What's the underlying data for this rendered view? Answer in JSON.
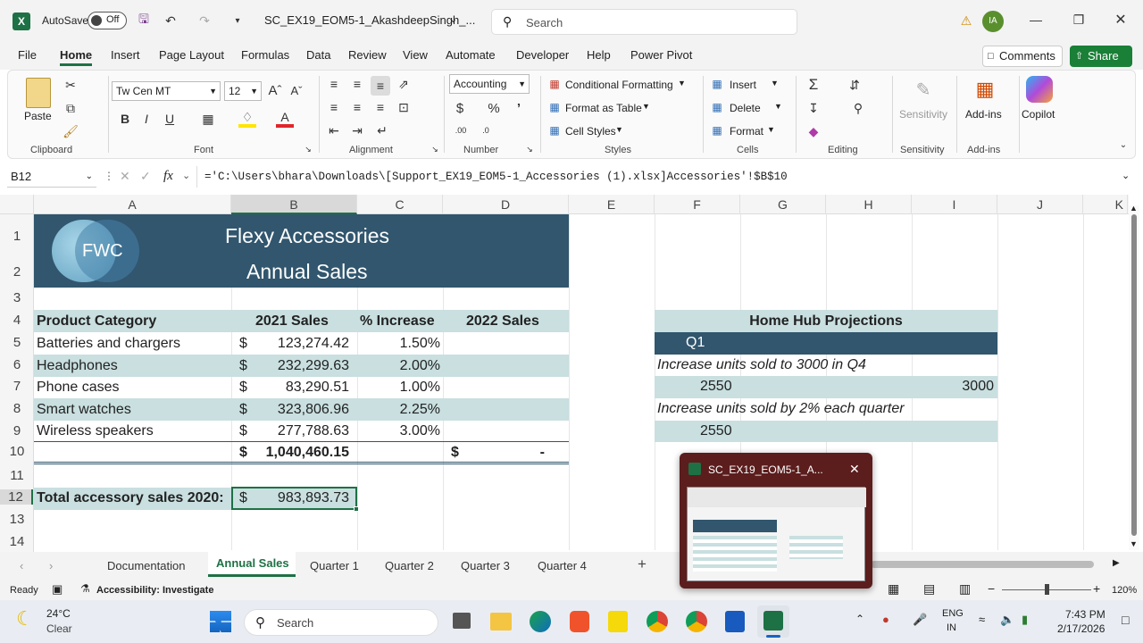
{
  "titlebar": {
    "autosave_label": "AutoSave",
    "autosave_state": "Off",
    "filename": "SC_EX19_EOM5-1_AkashdeepSingh_...",
    "search_placeholder": "Search",
    "avatar_initials": "IA"
  },
  "menu": {
    "items": [
      "File",
      "Home",
      "Insert",
      "Page Layout",
      "Formulas",
      "Data",
      "Review",
      "View",
      "Automate",
      "Developer",
      "Help",
      "Power Pivot"
    ],
    "comments": "Comments",
    "share": "Share"
  },
  "ribbon": {
    "clipboard": {
      "paste": "Paste",
      "label": "Clipboard"
    },
    "font": {
      "name": "Tw Cen MT",
      "size": "12",
      "label": "Font"
    },
    "alignment": {
      "label": "Alignment"
    },
    "number": {
      "format": "Accounting",
      "label": "Number"
    },
    "styles": {
      "conditional": "Conditional Formatting",
      "format_table": "Format as Table",
      "cell_styles": "Cell Styles",
      "label": "Styles"
    },
    "cells": {
      "insert": "Insert",
      "delete": "Delete",
      "format": "Format",
      "label": "Cells"
    },
    "editing": {
      "label": "Editing"
    },
    "sensitivity": {
      "button": "Sensitivity",
      "label": "Sensitivity"
    },
    "addins": {
      "button": "Add-ins",
      "label": "Add-ins"
    },
    "copilot": {
      "button": "Copilot"
    }
  },
  "formula_bar": {
    "name_box": "B12",
    "formula": "='C:\\Users\\bhara\\Downloads\\[Support_EX19_EOM5-1_Accessories (1).xlsx]Accessories'!$B$10"
  },
  "grid": {
    "columns": [
      "A",
      "B",
      "C",
      "D",
      "E",
      "F",
      "G",
      "H",
      "I",
      "J",
      "K"
    ],
    "rows": [
      "1",
      "2",
      "3",
      "4",
      "5",
      "6",
      "7",
      "8",
      "9",
      "10",
      "11",
      "12",
      "13",
      "14"
    ]
  },
  "sheet": {
    "logo_text": "FWC",
    "title1": "Flexy Accessories",
    "title2": "Annual Sales",
    "headers": [
      "Product Category",
      "2021 Sales",
      "% Increase",
      "2022 Sales"
    ],
    "products": [
      {
        "name": "Batteries and chargers",
        "cur": "$",
        "sales": "123,274.42",
        "pct": "1.50%"
      },
      {
        "name": "Headphones",
        "cur": "$",
        "sales": "232,299.63",
        "pct": "2.00%"
      },
      {
        "name": "Phone cases",
        "cur": "$",
        "sales": "83,290.51",
        "pct": "1.00%"
      },
      {
        "name": "Smart watches",
        "cur": "$",
        "sales": "323,806.96",
        "pct": "2.25%"
      },
      {
        "name": "Wireless speakers",
        "cur": "$",
        "sales": "277,788.63",
        "pct": "3.00%"
      }
    ],
    "total_cur": "$",
    "total_sales": "1,040,460.15",
    "total_2022_cur": "$",
    "total_2022": "-",
    "row12_label": "Total accessory sales 2020:",
    "row12_cur": "$",
    "row12_value": "983,893.73",
    "proj_title": "Home Hub Projections",
    "proj_q1": "Q1",
    "proj_line1": "Increase units sold to 3000 in Q4",
    "proj_val1": "2550",
    "proj_val2": "3000",
    "proj_line2": "Increase units sold by 2% each quarter",
    "proj_val3": "2550"
  },
  "sheet_tabs": [
    "Documentation",
    "Annual Sales",
    "Quarter 1",
    "Quarter 2",
    "Quarter 3",
    "Quarter 4"
  ],
  "popup": {
    "title": "SC_EX19_EOM5-1_A..."
  },
  "status": {
    "ready": "Ready",
    "accessibility": "Accessibility: Investigate",
    "zoom": "120%"
  },
  "taskbar": {
    "temp": "24°C",
    "weather": "Clear",
    "search": "Search",
    "lang1": "ENG",
    "lang2": "IN",
    "time": "7:43 PM",
    "date": "2/17/2026"
  },
  "colors": {
    "accent": "#1e7145",
    "header_band": "#31566e",
    "light_band": "#c9dfe0",
    "share": "#1a7f37"
  }
}
